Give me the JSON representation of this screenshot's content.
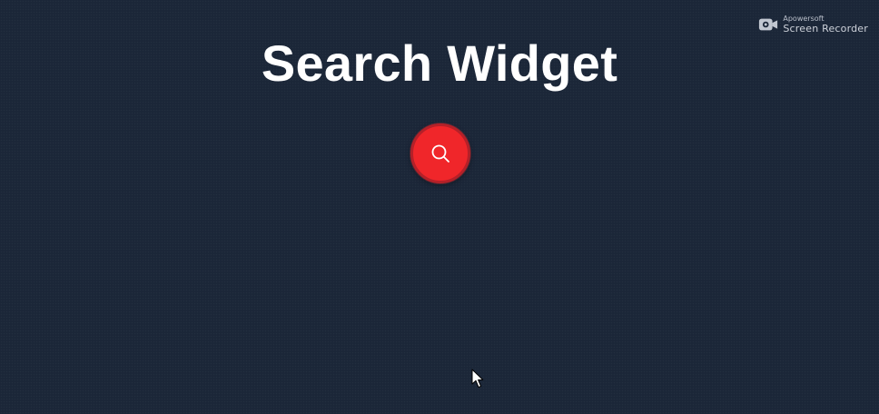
{
  "page": {
    "title": "Search Widget"
  },
  "search_button": {
    "icon": "search-icon",
    "color": "#f0262a",
    "border_color": "#b52028"
  },
  "watermark": {
    "brand": "Apowersoft",
    "product": "Screen Recorder",
    "icon": "camera-icon"
  },
  "colors": {
    "background": "#1b2638",
    "title": "#ffffff",
    "accent": "#f0262a"
  },
  "cursor": {
    "icon": "mouse-pointer-icon"
  }
}
